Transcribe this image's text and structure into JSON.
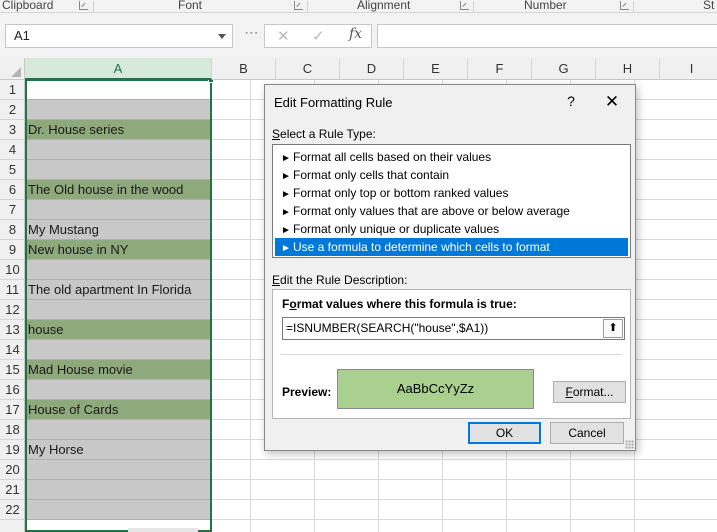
{
  "ribbon": {
    "groups": [
      "Clipboard",
      "Font",
      "Alignment",
      "Number",
      "St"
    ]
  },
  "formula_bar": {
    "name_box": "A1",
    "cancel_icon": "✕",
    "enter_icon": "✓",
    "fx_label": "fx",
    "formula": ""
  },
  "grid": {
    "columns": [
      "A",
      "B",
      "C",
      "D",
      "E",
      "F",
      "G",
      "H",
      "I"
    ],
    "rows": [
      "1",
      "2",
      "3",
      "4",
      "5",
      "6",
      "7",
      "8",
      "9",
      "10",
      "11",
      "12",
      "13",
      "14",
      "15",
      "16",
      "17",
      "18",
      "19",
      "20",
      "21",
      "22"
    ],
    "column_a": [
      "",
      "",
      "Dr. House series",
      "",
      "",
      "The Old house in the wood",
      "",
      "My Mustang",
      "New house in NY",
      "",
      "The old apartment In Florida",
      "",
      "house",
      "",
      "Mad House movie",
      "",
      "House of Cards",
      "",
      "My Horse",
      "",
      "",
      ""
    ],
    "highlighted_rows": [
      3,
      6,
      9,
      13,
      15,
      17
    ],
    "highlight_color": "#8ea97c",
    "selection_color": "#217346"
  },
  "dialog": {
    "title": "Edit Formatting Rule",
    "help": "?",
    "close": "✕",
    "rule_type_label_prefix": "",
    "rule_type_label_key": "S",
    "rule_type_label_rest": "elect a Rule Type:",
    "rule_types": [
      "Format all cells based on their values",
      "Format only cells that contain",
      "Format only top or bottom ranked values",
      "Format only values that are above or below average",
      "Format only unique or duplicate values",
      "Use a formula to determine which cells to format"
    ],
    "selected_rule_index": 5,
    "description_label_prefix": "",
    "description_label_key": "E",
    "description_label_rest": "dit the Rule Description:",
    "formula_label_prefix": "F",
    "formula_label_key": "o",
    "formula_label_rest": "rmat values where this formula is true:",
    "formula": "=ISNUMBER(SEARCH(\"house\",$A1))",
    "ref_button": "⬆",
    "preview_label": "Preview:",
    "preview_text": "AaBbCcYyZz",
    "preview_fill": "#a9d08e",
    "format_button_key": "F",
    "format_button_rest": "ormat...",
    "ok_button": "OK",
    "cancel_button": "Cancel",
    "accent": "#0078d7"
  }
}
